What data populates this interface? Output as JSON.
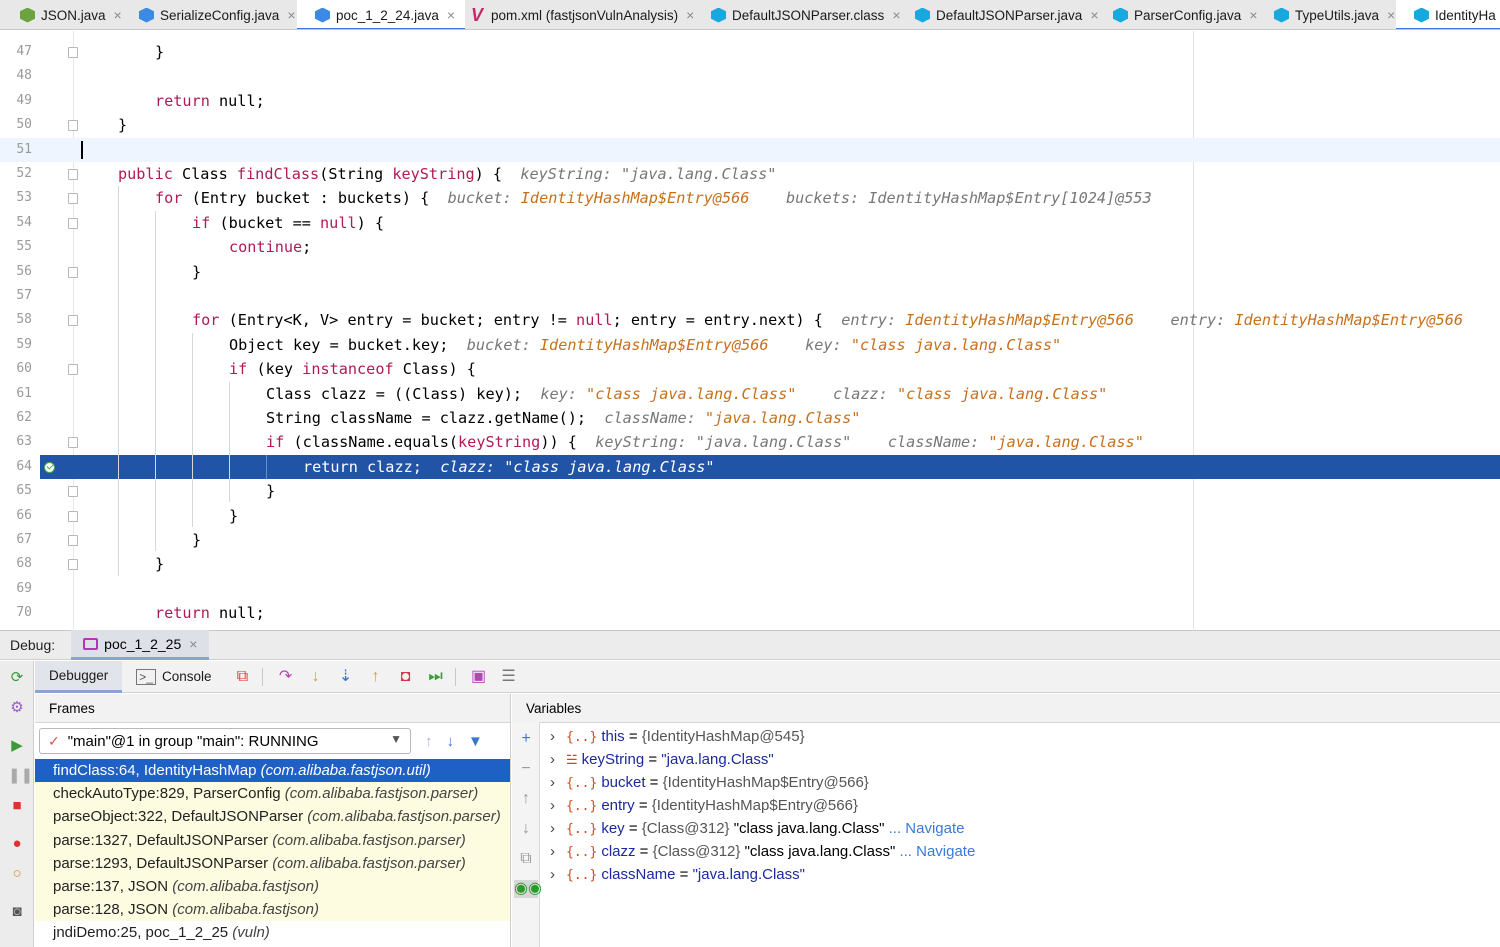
{
  "tabs": [
    {
      "label": "JSON.java",
      "icon": "json"
    },
    {
      "label": "SerializeConfig.java",
      "icon": "java"
    },
    {
      "label": "poc_1_2_24.java",
      "icon": "java"
    },
    {
      "label": "pom.xml (fastjsonVulnAnalysis)",
      "icon": "pom"
    },
    {
      "label": "DefaultJSONParser.class",
      "icon": "class"
    },
    {
      "label": "DefaultJSONParser.java",
      "icon": "java"
    },
    {
      "label": "ParserConfig.java",
      "icon": "java"
    },
    {
      "label": "TypeUtils.java",
      "icon": "java"
    },
    {
      "label": "IdentityHa",
      "icon": "java"
    }
  ],
  "editor": {
    "line_numbers": [
      "47",
      "48",
      "49",
      "50",
      "51",
      "52",
      "53",
      "54",
      "55",
      "56",
      "57",
      "58",
      "59",
      "60",
      "61",
      "62",
      "63",
      "64",
      "65",
      "66",
      "67",
      "68",
      "69",
      "70"
    ],
    "l47": "}",
    "l49_kw": "return",
    "l49_rest": " null;",
    "l50": "}",
    "l52_a": "public",
    "l52_b": " Class ",
    "l52_c": "findClass",
    "l52_d": "(String ",
    "l52_e": "keyString",
    "l52_f": ") {",
    "l52_hint_name": "keyString:",
    "l52_hint_val": " \"java.lang.Class\"",
    "l53_a": "for",
    "l53_b": " (Entry bucket : buckets) {",
    "l53_hint1": "bucket:",
    "l53_hint1_val": " IdentityHashMap$Entry@566",
    "l53_hint2": "buckets:",
    "l53_hint2_val": " IdentityHashMap$Entry[1024]@553",
    "l54_a": "if",
    "l54_b": " (bucket == ",
    "l54_c": "null",
    "l54_d": ") {",
    "l55": "continue",
    "l55_end": ";",
    "l56": "}",
    "l58_a": "for",
    "l58_b": " (Entry<K, V> entry = bucket; entry != ",
    "l58_c": "null",
    "l58_d": "; entry = entry.next) {",
    "l58_hint1": "entry:",
    "l58_hint1_val": " IdentityHashMap$Entry@566",
    "l58_hint2": "entry:",
    "l58_hint2_val": " IdentityHashMap$Entry@566",
    "l59_a": "Object key = bucket.key;",
    "l59_hint1": "bucket:",
    "l59_hint1_val": " IdentityHashMap$Entry@566",
    "l59_hint2": "key:",
    "l59_hint2_val": " \"class java.lang.Class\"",
    "l60_a": "if",
    "l60_b": " (key ",
    "l60_c": "instanceof",
    "l60_d": " Class) {",
    "l61_a": "Class clazz = ((Class) key);",
    "l61_hint1": "key:",
    "l61_hint1_val": " \"class java.lang.Class\"",
    "l61_hint2": "clazz:",
    "l61_hint2_val": " \"class java.lang.Class\"",
    "l62_a": "String className = clazz.getName();",
    "l62_hint1": "className:",
    "l62_hint1_val": " \"java.lang.Class\"",
    "l63_a": "if",
    "l63_b": " (className.equals(",
    "l63_c": "keyString",
    "l63_d": ")) {",
    "l63_hint1": "keyString:",
    "l63_hint1_val": " \"java.lang.Class\"",
    "l63_hint2": "className:",
    "l63_hint2_val": " \"java.lang.Class\"",
    "l64_a": "return",
    "l64_b": " clazz;",
    "l64_hint": "clazz: \"class java.lang.Class\"",
    "l65": "}",
    "l66": "}",
    "l67": "}",
    "l68": "}",
    "l70_kw": "return",
    "l70_rest": " null;"
  },
  "debug": {
    "label": "Debug:",
    "session": "poc_1_2_25",
    "tabs": {
      "debugger": "Debugger",
      "console": "Console"
    },
    "frames_title": "Frames",
    "variables_title": "Variables",
    "thread": "\"main\"@1 in group \"main\": RUNNING",
    "frames": [
      {
        "method": "findClass:64, IdentityHashMap ",
        "pkg": "(com.alibaba.fastjson.util)"
      },
      {
        "method": "checkAutoType:829, ParserConfig ",
        "pkg": "(com.alibaba.fastjson.parser)"
      },
      {
        "method": "parseObject:322, DefaultJSONParser ",
        "pkg": "(com.alibaba.fastjson.parser)"
      },
      {
        "method": "parse:1327, DefaultJSONParser ",
        "pkg": "(com.alibaba.fastjson.parser)"
      },
      {
        "method": "parse:1293, DefaultJSONParser ",
        "pkg": "(com.alibaba.fastjson.parser)"
      },
      {
        "method": "parse:137, JSON ",
        "pkg": "(com.alibaba.fastjson)"
      },
      {
        "method": "parse:128, JSON ",
        "pkg": "(com.alibaba.fastjson)"
      },
      {
        "method": "jndiDemo:25, poc_1_2_25 ",
        "pkg": "(vuln)"
      }
    ],
    "variables": [
      {
        "name": "this",
        "eq": " = ",
        "type": "{IdentityHashMap@545}",
        "value": "",
        "nav": ""
      },
      {
        "name": "keyString",
        "eq": " = ",
        "type": "",
        "value": "\"java.lang.Class\"",
        "nav": ""
      },
      {
        "name": "bucket",
        "eq": " = ",
        "type": "{IdentityHashMap$Entry@566}",
        "value": "",
        "nav": ""
      },
      {
        "name": "entry",
        "eq": " = ",
        "type": "{IdentityHashMap$Entry@566}",
        "value": "",
        "nav": ""
      },
      {
        "name": "key",
        "eq": " = ",
        "type": "{Class@312} ",
        "value": "\"class java.lang.Class\"",
        "nav": " ... Navigate"
      },
      {
        "name": "clazz",
        "eq": " = ",
        "type": "{Class@312} ",
        "value": "\"class java.lang.Class\"",
        "nav": " ... Navigate"
      },
      {
        "name": "className",
        "eq": " = ",
        "type": "",
        "value": "\"java.lang.Class\"",
        "nav": ""
      }
    ]
  },
  "colors": {
    "exec_line": "#2154a7",
    "selected_frame": "#1f60c7",
    "keyword": "#b01a56",
    "hint_value": "#c7701c"
  },
  "icons": [
    "check-icon",
    "dropdown-arrow-icon",
    "filter-icon",
    "rerun-icon",
    "resume-icon",
    "stop-icon"
  ]
}
